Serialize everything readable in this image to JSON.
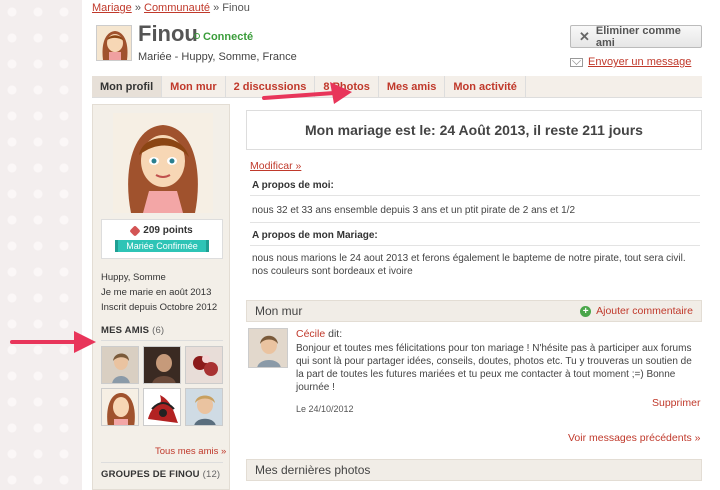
{
  "breadcrumb": {
    "item1": "Mariage",
    "sep": "»",
    "item2": "Communauté",
    "item3": "Finou"
  },
  "profile": {
    "name": "Finou",
    "status": "Connecté",
    "subtitle": "Mariée - Huppy, Somme, France"
  },
  "actions": {
    "remove_friend": "Eliminer comme ami",
    "send_message": "Envoyer un message"
  },
  "tabs": [
    {
      "label": "Mon profil"
    },
    {
      "label": "Mon mur"
    },
    {
      "label": "2 discussions"
    },
    {
      "label": "8 Photos"
    },
    {
      "label": "Mes amis"
    },
    {
      "label": "Mon activité"
    }
  ],
  "sidebar": {
    "points": "209 points",
    "badge": "Mariée Confirmée",
    "info": [
      "Huppy, Somme",
      "Je me marie en août 2013",
      "Inscrit depuis Octobre 2012"
    ],
    "friends_title": "MES AMIS",
    "friends_count": "(6)",
    "all_friends": "Tous mes amis »",
    "groups_title": "GROUPES DE FINOU",
    "groups_count": "(12)"
  },
  "main": {
    "wedding_banner": "Mon mariage est le: 24 Août 2013, il reste 211 jours",
    "modify": "Modificar »",
    "about_me_title": "A propos de moi:",
    "about_me_text": "nous 32 et 33 ans ensemble depuis 3 ans et un ptit pirate de 2 ans et 1/2",
    "about_wedding_title": "A propos de mon Mariage:",
    "about_wedding_text": "nous nous marions le 24 aout 2013 et ferons également le bapteme de notre pirate, tout sera civil. nos couleurs sont bordeaux et ivoire"
  },
  "wall": {
    "title": "Mon mur",
    "add_comment": "Ajouter commentaire",
    "post": {
      "author": "Cécile",
      "said": "dit:",
      "body": "Bonjour et toutes mes félicitations pour ton mariage ! N'hésite pas à participer aux forums qui sont là pour partager idées, conseils, doutes, photos etc. Tu y trouveras un soutien de la part de toutes les futures mariées et tu peux me contacter à tout moment ;=) Bonne journée !",
      "date": "Le 24/10/2012",
      "delete": "Supprimer"
    },
    "previous": "Voir messages précédents »"
  },
  "photos": {
    "title": "Mes dernières photos"
  },
  "colors": {
    "accent": "#c0392b",
    "online": "#3b9d3b",
    "badge": "#2ec4b6",
    "arrow": "#e8355a"
  }
}
